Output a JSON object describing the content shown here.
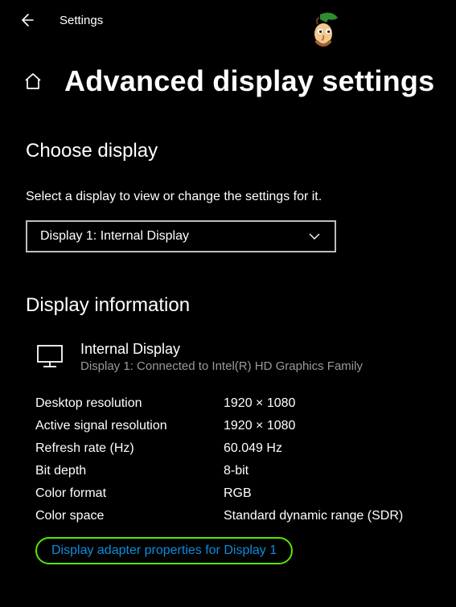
{
  "topbar": {
    "title": "Settings"
  },
  "page": {
    "title": "Advanced display settings"
  },
  "choose": {
    "heading": "Choose display",
    "subtext": "Select a display to view or change the settings for it.",
    "selected": "Display 1: Internal Display"
  },
  "info": {
    "heading": "Display information",
    "display_name": "Internal Display",
    "display_sub": "Display 1: Connected to Intel(R) HD Graphics Family",
    "rows": [
      {
        "label": "Desktop resolution",
        "value": "1920 × 1080"
      },
      {
        "label": "Active signal resolution",
        "value": "1920 × 1080"
      },
      {
        "label": "Refresh rate (Hz)",
        "value": "60.049 Hz"
      },
      {
        "label": "Bit depth",
        "value": "8-bit"
      },
      {
        "label": "Color format",
        "value": "RGB"
      },
      {
        "label": "Color space",
        "value": "Standard dynamic range (SDR)"
      }
    ],
    "adapter_link": "Display adapter properties for Display 1"
  }
}
